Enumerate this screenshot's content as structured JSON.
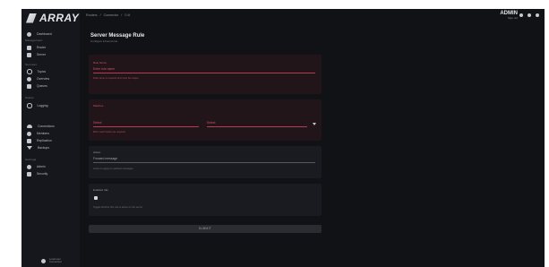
{
  "app": {
    "brand": "ARRAY"
  },
  "sidebar": {
    "items": [
      {
        "label": "Dashboard",
        "icon": "home-icon"
      },
      {
        "label": "Router",
        "icon": "router-icon"
      },
      {
        "label": "Server",
        "icon": "server-icon"
      },
      {
        "label": "Topics",
        "icon": "topic-icon"
      },
      {
        "label": "Overview",
        "icon": "overview-icon"
      },
      {
        "label": "Queues",
        "icon": "queue-icon"
      },
      {
        "label": "Logging",
        "icon": "logging-icon"
      },
      {
        "label": "Connections",
        "icon": "cloud-icon"
      },
      {
        "label": "Members",
        "icon": "members-icon"
      },
      {
        "label": "Replication",
        "icon": "replication-icon"
      },
      {
        "label": "Backups",
        "icon": "backup-icon"
      },
      {
        "label": "Admin",
        "icon": "admin-icon"
      },
      {
        "label": "Security",
        "icon": "security-icon"
      }
    ],
    "sections": [
      "Management",
      "Services",
      "Status",
      "Settings"
    ]
  },
  "user": {
    "name": "Local user",
    "status": "Connected"
  },
  "topbar": {
    "breadcrumb": [
      "Routers",
      "/",
      "Connector",
      "/",
      "Edit"
    ],
    "account_name": "ADMIN",
    "account_sub": "Sign out"
  },
  "page": {
    "title": "Server Message Rule",
    "subtitle": "Configure inbound rule"
  },
  "form": {
    "name": {
      "label": "Rule Name",
      "value": "",
      "placeholder": "Enter rule name",
      "hint": "Rule name is required and must be unique"
    },
    "match": {
      "label": "Matches",
      "left_value": "",
      "left_placeholder": "Select",
      "right_value": "",
      "right_placeholder": "Select",
      "hint": "Both match fields are required"
    },
    "action": {
      "label": "Action",
      "value": "Forward message",
      "hint": "Action to apply to matched messages"
    },
    "enabled": {
      "label": "Enabled rule",
      "checked": true,
      "hint": "Toggle whether this rule is active on the server"
    },
    "submit_label": "SUBMIT"
  },
  "colors": {
    "background": "#111216",
    "card": "#1a1b20",
    "error": "#b83b55"
  }
}
